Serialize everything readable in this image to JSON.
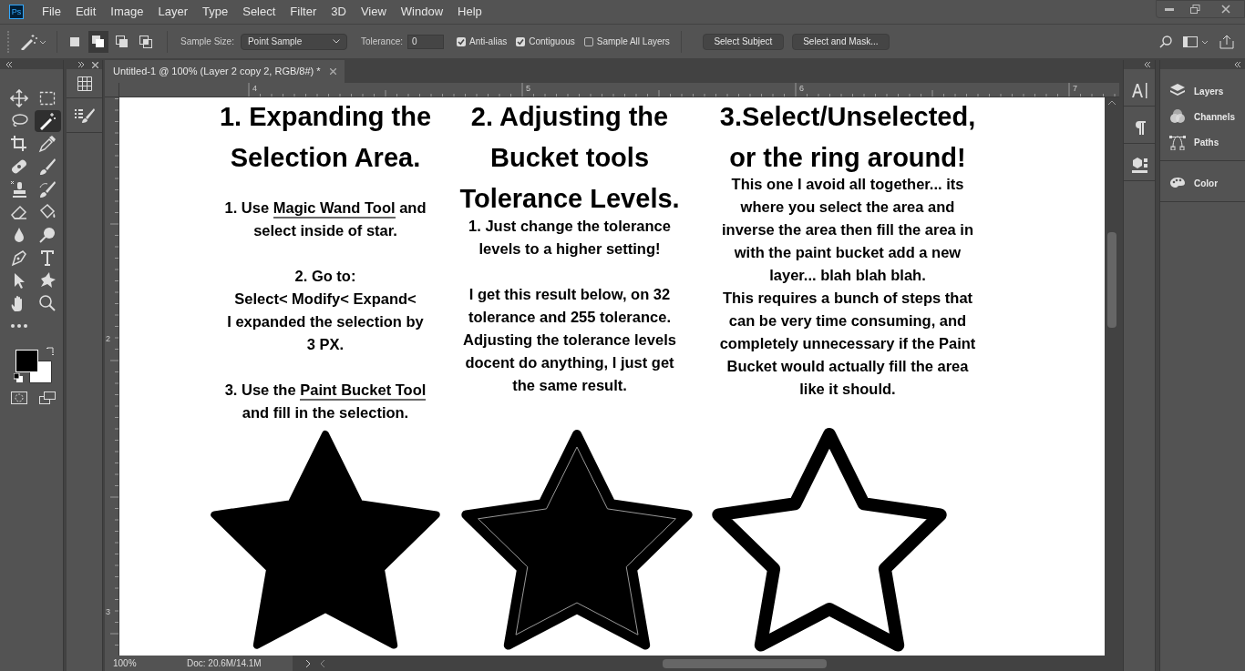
{
  "app_icon": "Ps",
  "menu": [
    "File",
    "Edit",
    "Image",
    "Layer",
    "Type",
    "Select",
    "Filter",
    "3D",
    "View",
    "Window",
    "Help"
  ],
  "options": {
    "selection_modes": [
      {
        "kind": "new",
        "selected": false
      },
      {
        "kind": "add",
        "selected": true
      },
      {
        "kind": "subtract",
        "selected": false
      },
      {
        "kind": "intersect",
        "selected": false
      }
    ],
    "sample_size_label": "Sample Size:",
    "sample_size": "Point Sample",
    "tolerance_label": "Tolerance:",
    "tolerance": "0",
    "checkboxes": [
      {
        "label": "Anti-alias",
        "checked": true
      },
      {
        "label": "Contiguous",
        "checked": true
      },
      {
        "label": "Sample All Layers",
        "checked": false
      }
    ],
    "buttons": [
      "Select Subject",
      "Select and Mask..."
    ]
  },
  "tools": [
    {
      "kind": "move",
      "selected": false
    },
    {
      "kind": "marquee",
      "selected": false
    },
    {
      "kind": "lasso",
      "selected": false
    },
    {
      "kind": "wand",
      "selected": true
    },
    {
      "kind": "crop",
      "selected": false
    },
    {
      "kind": "eyedropper",
      "selected": false
    },
    {
      "kind": "bandage",
      "selected": false
    },
    {
      "kind": "brush",
      "selected": false
    },
    {
      "kind": "stamp",
      "selected": false
    },
    {
      "kind": "history",
      "selected": false
    },
    {
      "kind": "eraser",
      "selected": false
    },
    {
      "kind": "bucket",
      "selected": false
    },
    {
      "kind": "drop",
      "selected": false
    },
    {
      "kind": "dodge",
      "selected": false
    },
    {
      "kind": "pen",
      "selected": false
    },
    {
      "kind": "type",
      "selected": false
    },
    {
      "kind": "arrow",
      "selected": false
    },
    {
      "kind": "shape",
      "selected": false
    },
    {
      "kind": "hand",
      "selected": false
    },
    {
      "kind": "zoom",
      "selected": false
    },
    {
      "kind": "more",
      "selected": false
    }
  ],
  "document": {
    "tab_title": "Untitled-1 @ 100% (Layer 2 copy 2, RGB/8#) *",
    "ruler_h": [
      "4",
      "5",
      "6",
      "7"
    ],
    "ruler_v": [
      "2",
      "3"
    ],
    "columns": [
      {
        "heading": [
          "1. Expanding the",
          "Selection Area."
        ],
        "paragraphs": [
          [
            [
              {
                "text": "1. Use ",
                "underlined": false
              },
              {
                "text": "Magic Wand Tool",
                "underlined": true
              },
              {
                "text": " and",
                "underlined": false
              }
            ],
            [
              {
                "text": "select inside of star.",
                "underlined": false
              }
            ]
          ],
          [
            [
              {
                "text": "2. Go to:",
                "underlined": false
              }
            ],
            [
              {
                "text": "Select< Modify< Expand<",
                "underlined": false
              }
            ],
            [
              {
                "text": "I expanded the selection by",
                "underlined": false
              }
            ],
            [
              {
                "text": "3 PX.",
                "underlined": false
              }
            ]
          ],
          [
            [
              {
                "text": "3. Use the ",
                "underlined": false
              },
              {
                "text": "Paint Bucket Tool",
                "underlined": true
              }
            ],
            [
              {
                "text": "and fill in the selection.",
                "underlined": false
              }
            ]
          ]
        ],
        "star": {
          "kind": "filled"
        }
      },
      {
        "heading": [
          "2. Adjusting the",
          "Bucket tools",
          "Tolerance Levels."
        ],
        "paragraphs": [
          [
            [
              {
                "text": "1. Just change the tolerance",
                "underlined": false
              }
            ],
            [
              {
                "text": "levels to a higher setting!",
                "underlined": false
              }
            ]
          ],
          [
            [
              {
                "text": "I get this result below, on 32",
                "underlined": false
              }
            ],
            [
              {
                "text": "tolerance and 255 tolerance.",
                "underlined": false
              }
            ],
            [
              {
                "text": "Adjusting the tolerance levels",
                "underlined": false
              }
            ],
            [
              {
                "text": "docent do anything, I just get",
                "underlined": false
              }
            ],
            [
              {
                "text": "the same result.",
                "underlined": false
              }
            ]
          ]
        ],
        "star": {
          "kind": "outlined"
        }
      },
      {
        "heading": [
          "3.Select/Unselected,",
          "or the ring around!"
        ],
        "paragraphs": [
          [
            [
              {
                "text": "This one I avoid all together... its",
                "underlined": false
              }
            ],
            [
              {
                "text": "where you select the area and",
                "underlined": false
              }
            ],
            [
              {
                "text": "inverse the area then fill the area in",
                "underlined": false
              }
            ],
            [
              {
                "text": "with the paint bucket add a new",
                "underlined": false
              }
            ],
            [
              {
                "text": "layer... blah blah blah.",
                "underlined": false
              }
            ],
            [
              {
                "text": "This requires a bunch of steps that",
                "underlined": false
              }
            ],
            [
              {
                "text": "can be very time consuming, and",
                "underlined": false
              }
            ],
            [
              {
                "text": "completely unnecessary if the Paint",
                "underlined": false
              }
            ],
            [
              {
                "text": "Bucket would actually fill the area",
                "underlined": false
              }
            ],
            [
              {
                "text": "like it should.",
                "underlined": false
              }
            ]
          ]
        ],
        "star": {
          "kind": "ring"
        }
      }
    ]
  },
  "status": {
    "zoom": "100%",
    "doc": "Doc: 20.6M/14.1M"
  },
  "narrow_panels": [
    {
      "kind": "character"
    },
    {
      "kind": "paragraph"
    },
    {
      "kind": "object"
    }
  ],
  "panels": [
    {
      "kind": "layers",
      "label": "Layers"
    },
    {
      "kind": "channels",
      "label": "Channels"
    },
    {
      "kind": "paths",
      "label": "Paths"
    },
    {
      "kind": "color",
      "label": "Color"
    }
  ]
}
